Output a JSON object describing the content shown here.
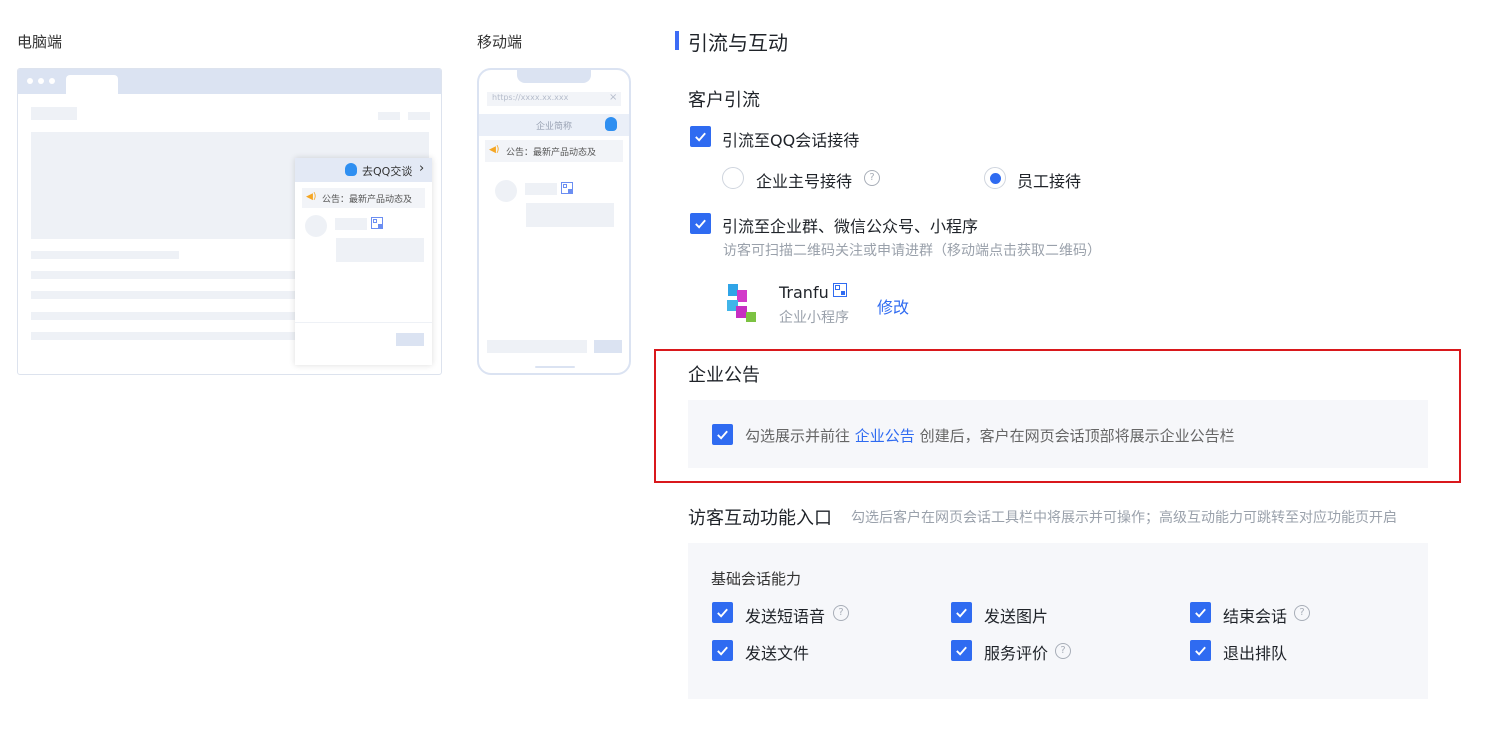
{
  "preview": {
    "pc_label": "电脑端",
    "mobile_label": "移动端",
    "pc_panel_button": "去QQ交谈",
    "pc_notice": "公告：最新产品动态及",
    "mobile_url": "https://xxxx.xx.xxx",
    "mobile_header": "企业简称",
    "mobile_notice": "公告：最新产品动态及"
  },
  "section": {
    "title": "引流与互动"
  },
  "customer_flow": {
    "title": "客户引流",
    "qq_option": {
      "label": "引流至QQ会话接待",
      "checked": true
    },
    "reception": {
      "options": [
        "企业主号接待",
        "员工接待"
      ],
      "selected": "员工接待"
    },
    "group_option": {
      "label": "引流至企业群、微信公众号、小程序",
      "checked": true,
      "hint": "访客可扫描二维码关注或申请进群（移动端点击获取二维码）"
    },
    "mini_program": {
      "name": "Tranfu",
      "type": "企业小程序",
      "edit_label": "修改"
    }
  },
  "announcement": {
    "title": "企业公告",
    "checked": true,
    "text_before": "勾选展示并前往",
    "link_text": "企业公告",
    "text_after": "创建后，客户在网页会话顶部将展示企业公告栏"
  },
  "interaction": {
    "title": "访客互动功能入口",
    "hint": "勾选后客户在网页会话工具栏中将展示并可操作；高级互动能力可跳转至对应功能页开启",
    "group_title": "基础会话能力",
    "items": [
      {
        "label": "发送短语音",
        "checked": true,
        "help": true
      },
      {
        "label": "发送图片",
        "checked": true,
        "help": false
      },
      {
        "label": "结束会话",
        "checked": true,
        "help": true
      },
      {
        "label": "发送文件",
        "checked": true,
        "help": false
      },
      {
        "label": "服务评价",
        "checked": true,
        "help": true
      },
      {
        "label": "退出排队",
        "checked": true,
        "help": false
      }
    ]
  },
  "colors": {
    "accent": "#2f6bf1",
    "highlight_border": "#d9181c"
  }
}
